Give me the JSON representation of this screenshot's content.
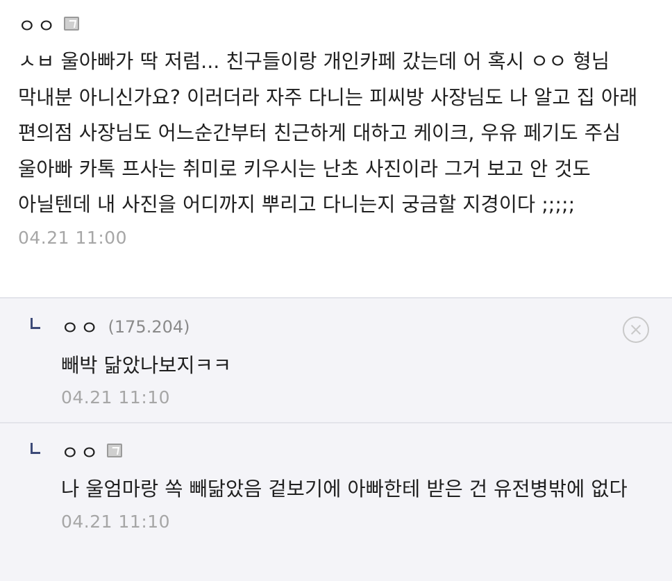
{
  "main_comment": {
    "nickname": "ㅇㅇ",
    "member_icon": "fixed-nick-icon",
    "text": "ㅅㅂ 울아빠가 딱 저럼... 친구들이랑 개인카페 갔는데 어 혹시 ㅇㅇ 형님 막내분 아니신가요? 이러더라 자주 다니는 피씨방 사장님도 나 알고 집 아래 편의점 사장님도 어느순간부터 친근하게 대하고 케이크, 우유 페기도 주심 울아빠 카톡 프사는 취미로 키우시는 난초 사진이라 그거 보고 안 것도 아닐텐데 내 사진을 어디까지 뿌리고 다니는지 궁금할 지경이다 ;;;;;",
    "timestamp": "04.21 11:00"
  },
  "replies": [
    {
      "nickname": "ㅇㅇ",
      "ip": "(175.204)",
      "text": "빼박 닮았나보지ㅋㅋ",
      "timestamp": "04.21 11:10",
      "delete_icon": "circle-x-icon"
    },
    {
      "nickname": "ㅇㅇ",
      "member_icon": "fixed-nick-icon",
      "text": "나 울엄마랑 쏙 빼닮았음 겉보기에 아빠한테 받은 건 유전병밖에 없다",
      "timestamp": "04.21 11:10"
    }
  ],
  "colors": {
    "reply_background": "#f4f4f8",
    "divider": "#e3e4ea",
    "timestamp": "#a6a6a6",
    "reply_arrow": "#3d4a78"
  }
}
